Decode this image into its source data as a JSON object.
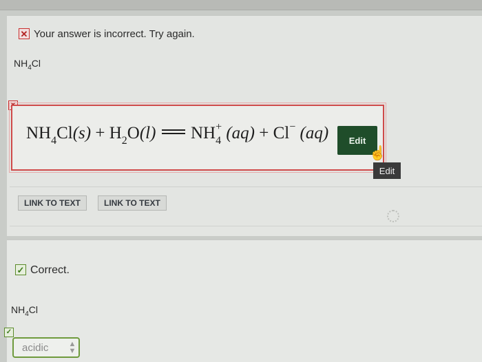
{
  "feedback": {
    "incorrect_icon": "x-icon",
    "incorrect_text": "Your answer is incorrect.  Try again.",
    "correct_icon": "check-icon",
    "correct_text": "Correct."
  },
  "question1": {
    "formula": {
      "base": "NH",
      "sub": "4",
      "tail": "Cl"
    },
    "equation": {
      "r1": "NH",
      "r1_sub": "4",
      "r1_tail": "Cl",
      "r1_state": "(s)",
      "plus1": "+",
      "r2": "H",
      "r2_sub": "2",
      "r2_tail": "O",
      "r2_state": "(l)",
      "p1": "NH",
      "p1_sub": "4",
      "p1_sup": "+",
      "p1_state": "(aq)",
      "plus2": "+",
      "p2": "Cl",
      "p2_sup": "−",
      "p2_state": "(aq)"
    },
    "edit_label": "Edit",
    "tooltip": "Edit",
    "links": [
      "LINK TO TEXT",
      "LINK TO TEXT"
    ]
  },
  "question2": {
    "formula": {
      "base": "NH",
      "sub": "4",
      "tail": "Cl"
    },
    "select_value": "acidic"
  },
  "colors": {
    "incorrect": "#c93030",
    "correct": "#5a8a2a",
    "edit_button": "#1f4d2a"
  }
}
